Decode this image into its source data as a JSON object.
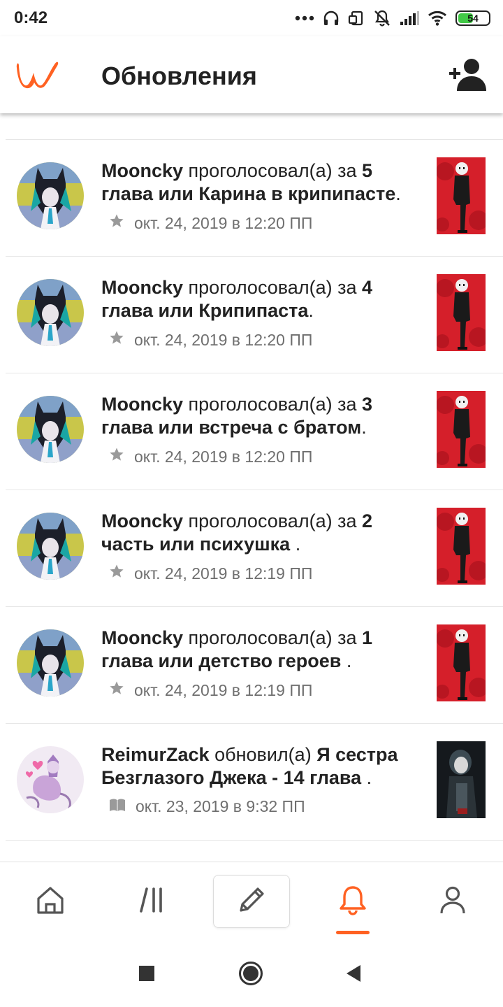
{
  "status_bar": {
    "time": "0:42",
    "battery": "54",
    "battery_level_percent": 54,
    "icons": [
      "dots-icon",
      "headphones-icon",
      "rotate-icon",
      "mute-icon",
      "signal-icon",
      "wifi-icon",
      "battery-icon"
    ]
  },
  "header": {
    "title": "Обновления",
    "logo": "wattpad-logo",
    "action_icon": "add-user-icon"
  },
  "colors": {
    "accent": "#ff6122",
    "text": "#222222",
    "meta": "#6f6f6f",
    "divider": "#e6e6e6"
  },
  "items": [
    {
      "user": "Mooncky",
      "action": "проголосовал(а) за",
      "story": "5 глава или Карина в крипипасте",
      "end": ".",
      "time": "окт. 24, 2019 в 12:20 ПП",
      "meta_icon": "star-icon",
      "avatar": "wolf-girl"
    },
    {
      "user": "Mooncky",
      "action": "проголосовал(а) за",
      "story": "4 глава или Крипипаста",
      "end": ".",
      "time": "окт. 24, 2019 в 12:20 ПП",
      "meta_icon": "star-icon",
      "avatar": "wolf-girl"
    },
    {
      "user": "Mooncky",
      "action": "проголосовал(а) за",
      "story": "3 глава или встреча с братом",
      "end": ".",
      "time": "окт. 24, 2019 в 12:20 ПП",
      "meta_icon": "star-icon",
      "avatar": "wolf-girl"
    },
    {
      "user": "Mooncky",
      "action": "проголосовал(а) за",
      "story": "2 часть или психушка",
      "end": " .",
      "time": "окт. 24, 2019 в 12:19 ПП",
      "meta_icon": "star-icon",
      "avatar": "wolf-girl"
    },
    {
      "user": "Mooncky",
      "action": "проголосовал(а) за",
      "story": "1 глава или детство героев",
      "end": " .",
      "time": "окт. 24, 2019 в 12:19 ПП",
      "meta_icon": "star-icon",
      "avatar": "wolf-girl"
    },
    {
      "user": "ReimurZack",
      "action": "обновил(а)",
      "story": "Я сестра Безглазого Джека - 14 глава",
      "end": " .",
      "time": "окт. 23, 2019 в 9:32 ПП",
      "meta_icon": "book-icon",
      "avatar": "purple-cat"
    }
  ],
  "bottom_nav": [
    {
      "name": "home",
      "icon": "home-icon",
      "active": false
    },
    {
      "name": "library",
      "icon": "library-icon",
      "active": false
    },
    {
      "name": "write",
      "icon": "pencil-icon",
      "active": false
    },
    {
      "name": "notifications",
      "icon": "bell-icon",
      "active": true
    },
    {
      "name": "profile",
      "icon": "profile-icon",
      "active": false
    }
  ],
  "system_nav": [
    "recents-icon",
    "home-circle-icon",
    "back-icon"
  ]
}
